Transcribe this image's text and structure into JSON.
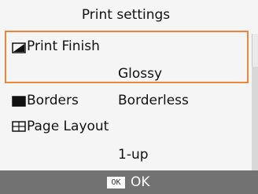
{
  "screen": {
    "title": "Print settings"
  },
  "settings": [
    {
      "label": "Print Finish",
      "value": "Glossy",
      "icon": "print-finish-icon"
    },
    {
      "label": "Borders",
      "value": "Borderless",
      "icon": "borders-icon"
    },
    {
      "label": "Page Layout",
      "value": "1-up",
      "icon": "page-layout-icon"
    }
  ],
  "bottom_bar": {
    "ok_badge": "OK",
    "ok_label": "OK"
  },
  "colors": {
    "highlight": "#e9873d",
    "background": "#f5f5f5",
    "bottom_bar": "#727272"
  }
}
